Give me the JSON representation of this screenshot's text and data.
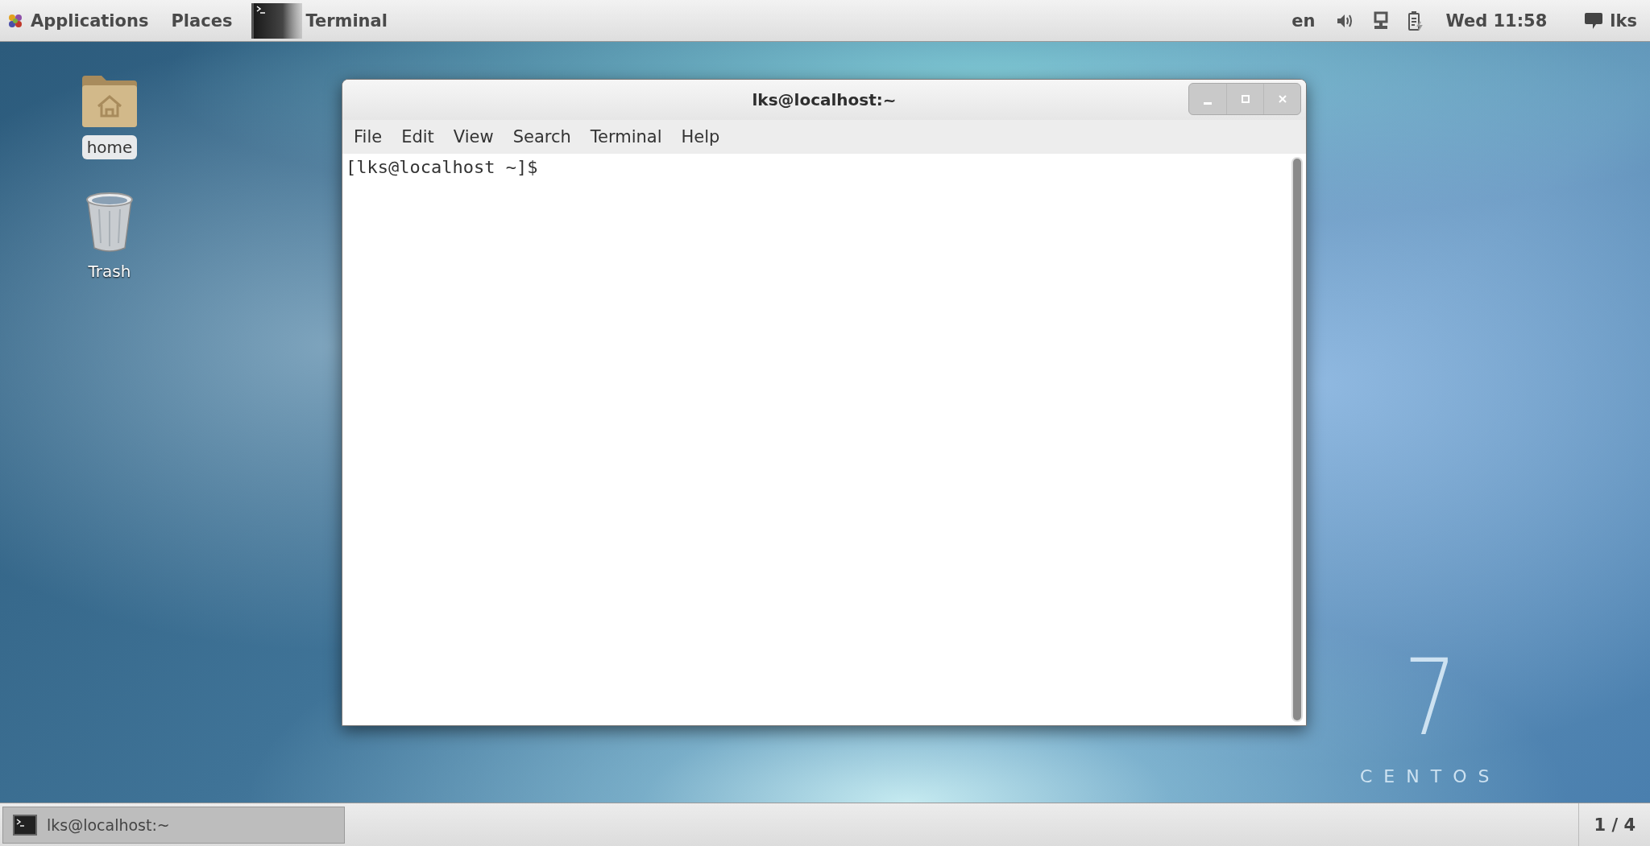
{
  "top_bar": {
    "menus": [
      "Applications",
      "Places"
    ],
    "active_app": "Terminal",
    "language": "en",
    "clock": "Wed 11:58",
    "user": "lks"
  },
  "desktop_icons": [
    {
      "kind": "home",
      "label": "home",
      "selected": true
    },
    {
      "kind": "trash",
      "label": "Trash",
      "selected": false
    }
  ],
  "wallpaper": {
    "logo_number": "7",
    "logo_text": "CENTOS"
  },
  "window": {
    "title": "lks@localhost:~",
    "menu": [
      "File",
      "Edit",
      "View",
      "Search",
      "Terminal",
      "Help"
    ],
    "prompt": "[lks@localhost ~]$"
  },
  "bottom_bar": {
    "tasks": [
      {
        "label": "lks@localhost:~",
        "selected": true
      }
    ],
    "workspace": "1 / 4"
  }
}
